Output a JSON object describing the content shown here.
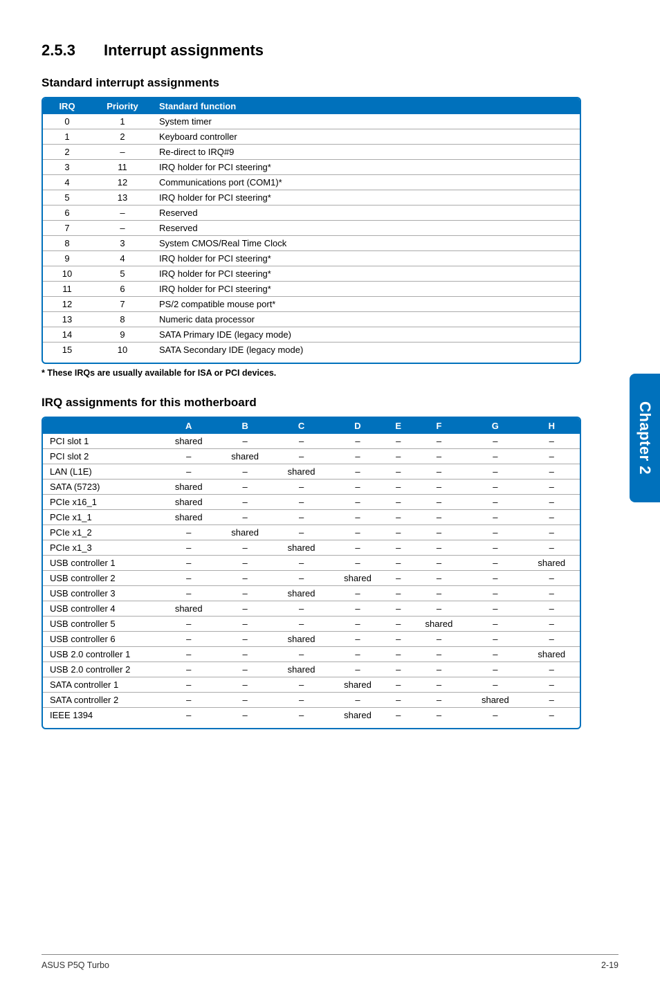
{
  "section": {
    "number": "2.5.3",
    "title": "Interrupt assignments"
  },
  "std": {
    "heading": "Standard interrupt assignments",
    "headers": {
      "irq": "IRQ",
      "priority": "Priority",
      "func": "Standard function"
    },
    "rows": [
      {
        "irq": "0",
        "pri": "1",
        "func": "System timer"
      },
      {
        "irq": "1",
        "pri": "2",
        "func": "Keyboard controller"
      },
      {
        "irq": "2",
        "pri": "–",
        "func": "Re-direct to IRQ#9"
      },
      {
        "irq": "3",
        "pri": "11",
        "func": "IRQ holder for PCI steering*"
      },
      {
        "irq": "4",
        "pri": "12",
        "func": "Communications port (COM1)*"
      },
      {
        "irq": "5",
        "pri": "13",
        "func": "IRQ holder for PCI steering*"
      },
      {
        "irq": "6",
        "pri": "–",
        "func": "Reserved"
      },
      {
        "irq": "7",
        "pri": "–",
        "func": "Reserved"
      },
      {
        "irq": "8",
        "pri": "3",
        "func": "System CMOS/Real Time Clock"
      },
      {
        "irq": "9",
        "pri": "4",
        "func": "IRQ holder for PCI steering*"
      },
      {
        "irq": "10",
        "pri": "5",
        "func": "IRQ holder for PCI steering*"
      },
      {
        "irq": "11",
        "pri": "6",
        "func": "IRQ holder for PCI steering*"
      },
      {
        "irq": "12",
        "pri": "7",
        "func": "PS/2 compatible mouse port*"
      },
      {
        "irq": "13",
        "pri": "8",
        "func": "Numeric data processor"
      },
      {
        "irq": "14",
        "pri": "9",
        "func": "SATA Primary IDE (legacy mode)"
      },
      {
        "irq": "15",
        "pri": "10",
        "func": "SATA Secondary IDE (legacy mode)"
      }
    ],
    "footnote": "* These IRQs are usually available for ISA or PCI devices."
  },
  "assign": {
    "heading": "IRQ assignments for this motherboard",
    "cols": [
      "A",
      "B",
      "C",
      "D",
      "E",
      "F",
      "G",
      "H"
    ],
    "rows": [
      {
        "label": "PCI slot 1",
        "v": [
          "shared",
          "–",
          "–",
          "–",
          "–",
          "–",
          "–",
          "–"
        ]
      },
      {
        "label": "PCI slot 2",
        "v": [
          "–",
          "shared",
          "–",
          "–",
          "–",
          "–",
          "–",
          "–"
        ]
      },
      {
        "label": "LAN (L1E)",
        "v": [
          "–",
          "–",
          "shared",
          "–",
          "–",
          "–",
          "–",
          "–"
        ]
      },
      {
        "label": "SATA (5723)",
        "v": [
          "shared",
          "–",
          "–",
          "–",
          "–",
          "–",
          "–",
          "–"
        ]
      },
      {
        "label": "PCIe x16_1",
        "v": [
          "shared",
          "–",
          "–",
          "–",
          "–",
          "–",
          "–",
          "–"
        ]
      },
      {
        "label": "PCIe x1_1",
        "v": [
          "shared",
          "–",
          "–",
          "–",
          "–",
          "–",
          "–",
          "–"
        ]
      },
      {
        "label": "PCIe x1_2",
        "v": [
          "–",
          "shared",
          "–",
          "–",
          "–",
          "–",
          "–",
          "–"
        ]
      },
      {
        "label": "PCIe x1_3",
        "v": [
          "–",
          "–",
          "shared",
          "–",
          "–",
          "–",
          "–",
          "–"
        ]
      },
      {
        "label": "USB controller 1",
        "v": [
          "–",
          "–",
          "–",
          "–",
          "–",
          "–",
          "–",
          "shared"
        ]
      },
      {
        "label": "USB controller 2",
        "v": [
          "–",
          "–",
          "–",
          "shared",
          "–",
          "–",
          "–",
          "–"
        ]
      },
      {
        "label": "USB controller 3",
        "v": [
          "–",
          "–",
          "shared",
          "–",
          "–",
          "–",
          "–",
          "–"
        ]
      },
      {
        "label": "USB controller 4",
        "v": [
          "shared",
          "–",
          "–",
          "–",
          "–",
          "–",
          "–",
          "–"
        ]
      },
      {
        "label": "USB controller 5",
        "v": [
          "–",
          "–",
          "–",
          "–",
          "–",
          "shared",
          "–",
          "–"
        ]
      },
      {
        "label": "USB controller 6",
        "v": [
          "–",
          "–",
          "shared",
          "–",
          "–",
          "–",
          "–",
          "–"
        ]
      },
      {
        "label": "USB 2.0 controller 1",
        "v": [
          "–",
          "–",
          "–",
          "–",
          "–",
          "–",
          "–",
          "shared"
        ]
      },
      {
        "label": "USB 2.0 controller 2",
        "v": [
          "–",
          "–",
          "shared",
          "–",
          "–",
          "–",
          "–",
          "–"
        ]
      },
      {
        "label": "SATA controller 1",
        "v": [
          "–",
          "–",
          "–",
          "shared",
          "–",
          "–",
          "–",
          "–"
        ]
      },
      {
        "label": "SATA controller 2",
        "v": [
          "–",
          "–",
          "–",
          "–",
          "–",
          "–",
          "shared",
          "–"
        ]
      },
      {
        "label": "IEEE 1394",
        "v": [
          "–",
          "–",
          "–",
          "shared",
          "–",
          "–",
          "–",
          "–"
        ]
      }
    ]
  },
  "chapter_tab": "Chapter 2",
  "footer": {
    "left": "ASUS P5Q Turbo",
    "right": "2-19"
  }
}
